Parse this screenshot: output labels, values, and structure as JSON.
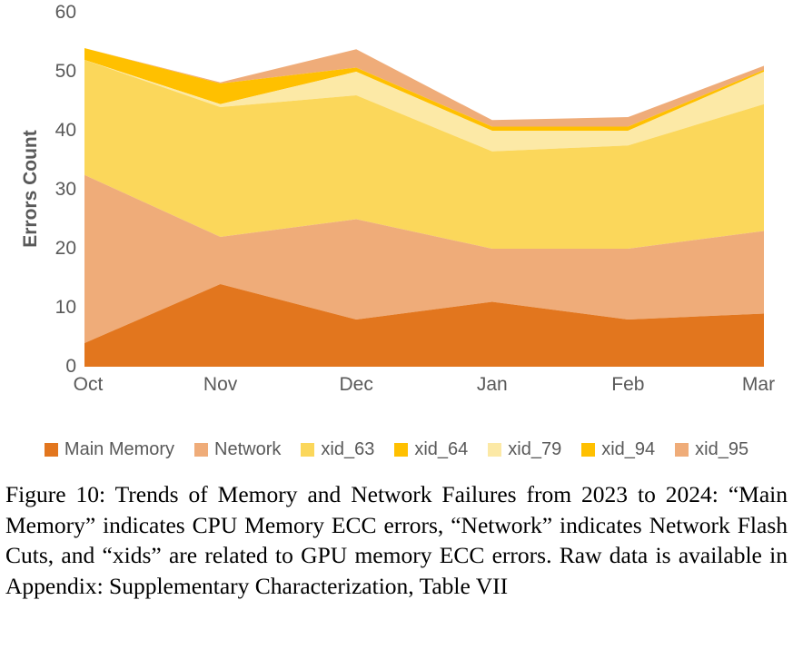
{
  "figure": {
    "caption": "Figure 10: Trends of Memory and Network Failures from 2023 to 2024: “Main Memory” indicates CPU Memory ECC errors, “Network” indicates Network Flash Cuts, and “xids” are related to GPU memory ECC errors. Raw data is available in Appendix: Supplementary Characterization, Table VII"
  },
  "chart_data": {
    "type": "area",
    "stacked": true,
    "title": "",
    "xlabel": "",
    "ylabel": "Errors Count",
    "categories": [
      "Oct",
      "Nov",
      "Dec",
      "Jan",
      "Feb",
      "Mar"
    ],
    "ylim": [
      0,
      60
    ],
    "yticks": [
      0,
      10,
      20,
      30,
      40,
      50,
      60
    ],
    "grid": false,
    "legend_position": "bottom",
    "series": [
      {
        "name": "Main Memory",
        "color": "#E2761E",
        "values": [
          4,
          14,
          8,
          11,
          8,
          9
        ]
      },
      {
        "name": "Network",
        "color": "#EFAC79",
        "values": [
          28.5,
          8,
          17,
          9,
          12,
          14
        ]
      },
      {
        "name": "xid_63",
        "color": "#FBD75B",
        "values": [
          19.5,
          22,
          21,
          16.5,
          17.5,
          21.5
        ]
      },
      {
        "name": "xid_64",
        "color": "#FFC000",
        "values": [
          0,
          0,
          0,
          0,
          0,
          0
        ]
      },
      {
        "name": "xid_79",
        "color": "#FCE9A6",
        "values": [
          0,
          0.5,
          4,
          3.5,
          2.5,
          5.5
        ]
      },
      {
        "name": "xid_94",
        "color": "#FFC000",
        "values": [
          2,
          3.5,
          0.7,
          0.7,
          0.7,
          0.3
        ]
      },
      {
        "name": "xid_95",
        "color": "#EFAC79",
        "values": [
          0,
          0.2,
          3.1,
          1.1,
          1.6,
          0.7
        ]
      }
    ],
    "cumulative_tops": [
      {
        "name": "Main Memory",
        "values": [
          4,
          14,
          8,
          11,
          8,
          9
        ]
      },
      {
        "name": "Network",
        "values": [
          32.5,
          22,
          25,
          20,
          20,
          23
        ]
      },
      {
        "name": "xid_63",
        "values": [
          52,
          44,
          46,
          36.5,
          37.5,
          44.5
        ]
      },
      {
        "name": "xid_64",
        "values": [
          52,
          44,
          46,
          36.5,
          37.5,
          44.5
        ]
      },
      {
        "name": "xid_79",
        "values": [
          52,
          44.5,
          50,
          40,
          40,
          50
        ]
      },
      {
        "name": "xid_94",
        "values": [
          54,
          48,
          50.7,
          40.7,
          40.7,
          50.3
        ]
      },
      {
        "name": "xid_95",
        "values": [
          54,
          48.2,
          53.8,
          41.8,
          42.3,
          51
        ]
      }
    ]
  },
  "legend": {
    "items": [
      {
        "label": "Main Memory",
        "color": "#E2761E"
      },
      {
        "label": "Network",
        "color": "#EFAC79"
      },
      {
        "label": "xid_63",
        "color": "#FBD75B"
      },
      {
        "label": "xid_64",
        "color": "#FFC000"
      },
      {
        "label": "xid_79",
        "color": "#FCE9A6"
      },
      {
        "label": "xid_94",
        "color": "#FFC000"
      },
      {
        "label": "xid_95",
        "color": "#EFAC79"
      }
    ]
  },
  "axis": {
    "y_title": "Errors Count",
    "y_labels": [
      "60",
      "50",
      "40",
      "30",
      "20",
      "10",
      "0"
    ],
    "x_labels": [
      "Oct",
      "Nov",
      "Dec",
      "Jan",
      "Feb",
      "Mar"
    ]
  }
}
